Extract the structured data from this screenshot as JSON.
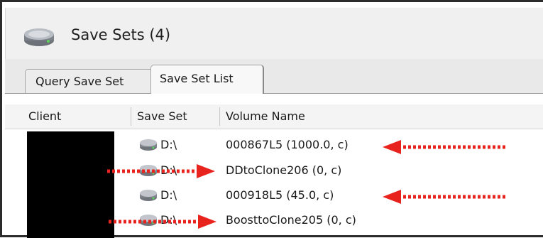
{
  "window": {
    "title": "Save Sets (4)"
  },
  "tabs": [
    {
      "label": "Query Save Set",
      "active": false
    },
    {
      "label": "Save Set List",
      "active": true
    }
  ],
  "table": {
    "columns": [
      "Client",
      "Save Set",
      "Volume Name"
    ],
    "rows": [
      {
        "client": "",
        "save_set": "D:\\",
        "volume_name": "000867L5 (1000.0, c)"
      },
      {
        "client": "",
        "save_set": "D:\\",
        "volume_name": "DDtoClone206 (0, c)"
      },
      {
        "client": "",
        "save_set": "D:\\",
        "volume_name": "000918L5 (45.0, c)"
      },
      {
        "client": "",
        "save_set": "D:\\",
        "volume_name": "BoosttoClone205 (0, c)"
      }
    ]
  },
  "colors": {
    "annotation_arrow": "#e8231e",
    "redaction": "#000000"
  },
  "icons": {
    "window": "storage-drive-icon",
    "save_set": "drive-icon"
  }
}
